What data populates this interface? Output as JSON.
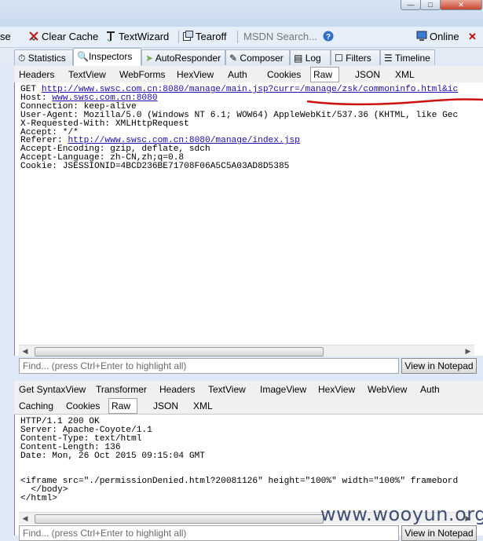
{
  "toolbar": {
    "partial_label": "se",
    "clear_cache": "Clear Cache",
    "textwizard": "TextWizard",
    "tearoff": "Tearoff",
    "msdn_search": "MSDN Search...",
    "online": "Online"
  },
  "main_tabs": [
    {
      "label": "Statistics",
      "icon": "stopwatch-icon"
    },
    {
      "label": "Inspectors",
      "icon": "magnifier-icon",
      "active": true
    },
    {
      "label": "AutoResponder",
      "icon": "lightning-icon"
    },
    {
      "label": "Composer",
      "icon": "pencil-icon"
    },
    {
      "label": "Log",
      "icon": "log-icon"
    },
    {
      "label": "Filters",
      "icon": "checkbox-icon"
    },
    {
      "label": "Timeline",
      "icon": "timeline-icon"
    }
  ],
  "request_tabs": [
    "Headers",
    "TextView",
    "WebForms",
    "HexView",
    "Auth",
    "Cookies",
    "Raw",
    "JSON",
    "XML"
  ],
  "request_selected": "Raw",
  "request": {
    "get_prefix": "GET ",
    "get_url": "http://www.swsc.com.cn:8080/manage/main.jsp?curr=/manage/zsk/commoninfo.html&ic",
    "host_prefix": "Host: ",
    "host_url": "www.swsc.com.cn:8080",
    "connection": "Connection: keep-alive",
    "user_agent": "User-Agent: Mozilla/5.0 (Windows NT 6.1; WOW64) AppleWebKit/537.36 (KHTML, like Gec",
    "x_requested": "X-Requested-With: XMLHttpRequest",
    "accept": "Accept: */*",
    "referer_prefix": "Referer: ",
    "referer_url": "http://www.swsc.com.cn:8080/manage/index.jsp",
    "accept_encoding": "Accept-Encoding: gzip, deflate, sdch",
    "accept_language": "Accept-Language: zh-CN,zh;q=0.8",
    "cookie": "Cookie: JSESSIONID=4BCD236BE71708F06A5C5A03AD8D5385"
  },
  "find": {
    "placeholder": "Find... (press Ctrl+Enter to highlight all)",
    "button": "View in Notepad"
  },
  "response_tabs_row1": [
    "Get SyntaxView",
    "Transformer",
    "Headers",
    "TextView",
    "ImageView",
    "HexView",
    "WebView",
    "Auth"
  ],
  "response_tabs_row2": [
    "Caching",
    "Cookies",
    "Raw",
    "JSON",
    "XML"
  ],
  "response_selected": "Raw",
  "response": {
    "status": "HTTP/1.1 200 OK",
    "server": "Server: Apache-Coyote/1.1",
    "content_type": "Content-Type: text/html",
    "content_length": "Content-Length: 136",
    "date": "Date: Mon, 26 Oct 2015 09:15:04 GMT",
    "iframe": "<iframe src=\"./permissionDenied.html?20081126\" height=\"100%\" width=\"100%\" framebord",
    "body_close": "  </body>",
    "html_close": "</html>"
  },
  "watermark": "www.wooyun.org",
  "colors": {
    "annotation_red": "#cc1111",
    "link_blue": "#1a0dab"
  }
}
